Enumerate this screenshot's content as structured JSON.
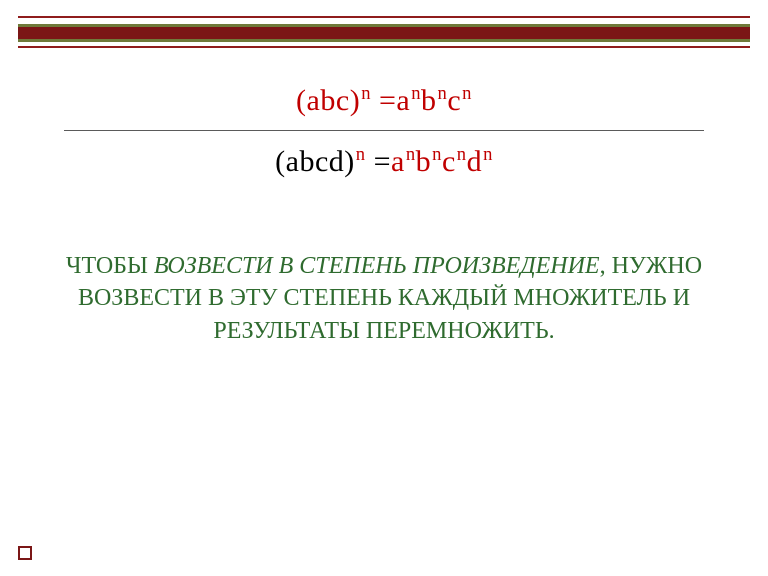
{
  "colors": {
    "red": "#c00000",
    "darkRed": "#7b1616",
    "olive": "#6f7a3a",
    "green": "#2f6b2f"
  },
  "formula1": {
    "lparen": "(",
    "a": "a",
    "b": "b",
    "c": "c",
    "rparen_sup_n": ")",
    "sup_n": "n",
    "eq": " =",
    "ra": "a",
    "ra_n": "n",
    "rb": "b",
    "rb_n": "n",
    "rc": "c",
    "rc_n": "n"
  },
  "formula2": {
    "lparen": "(",
    "a": "a",
    "b": "b",
    "c": "c",
    "d": "d",
    "rparen": ")",
    "sup_n": "n",
    "eq": " =",
    "ra": "a",
    "ra_n": "n",
    "rb": "b",
    "rb_n": "n",
    "rc": "c",
    "rc_n": "n",
    "rd": "d",
    "rd_n": "n"
  },
  "rule": {
    "part1": "ЧТОБЫ ",
    "emph": "ВОЗВЕСТИ В СТЕПЕНЬ ПРОИЗВЕДЕНИЕ",
    "part2": ", НУЖНО ВОЗВЕСТИ В ЭТУ СТЕПЕНЬ КАЖДЫЙ МНОЖИТЕЛЬ И РЕЗУЛЬТАТЫ ПЕРЕМНОЖИТЬ."
  }
}
